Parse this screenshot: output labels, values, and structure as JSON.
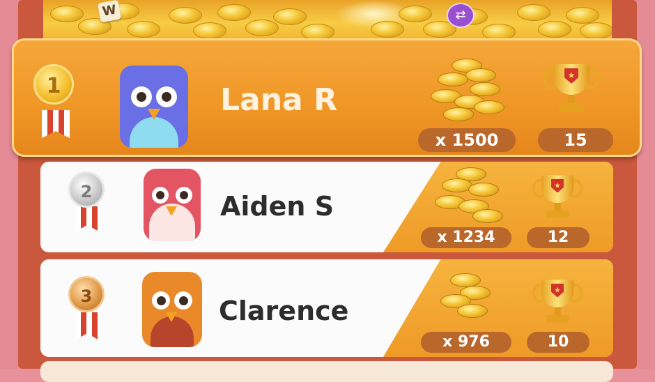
{
  "header": {
    "tile_letter": "W",
    "shuffle_icon": "shuffle-icon"
  },
  "leaderboard": [
    {
      "rank": "1",
      "name": "Lana R",
      "coins": "x 1500",
      "trophies": "15",
      "avatar": "blue-bird",
      "medal": "gold"
    },
    {
      "rank": "2",
      "name": "Aiden S",
      "coins": "x 1234",
      "trophies": "12",
      "avatar": "red-bird",
      "medal": "silver"
    },
    {
      "rank": "3",
      "name": "Clarence",
      "coins": "x 976",
      "trophies": "10",
      "avatar": "orange-bird",
      "medal": "bronze"
    }
  ],
  "colors": {
    "accent_orange": "#ef9626",
    "gold_medal": "#f5c02f",
    "silver_medal": "#b8b8b8",
    "bronze_medal": "#e09a4a",
    "pill_brown": "#b9672a"
  }
}
